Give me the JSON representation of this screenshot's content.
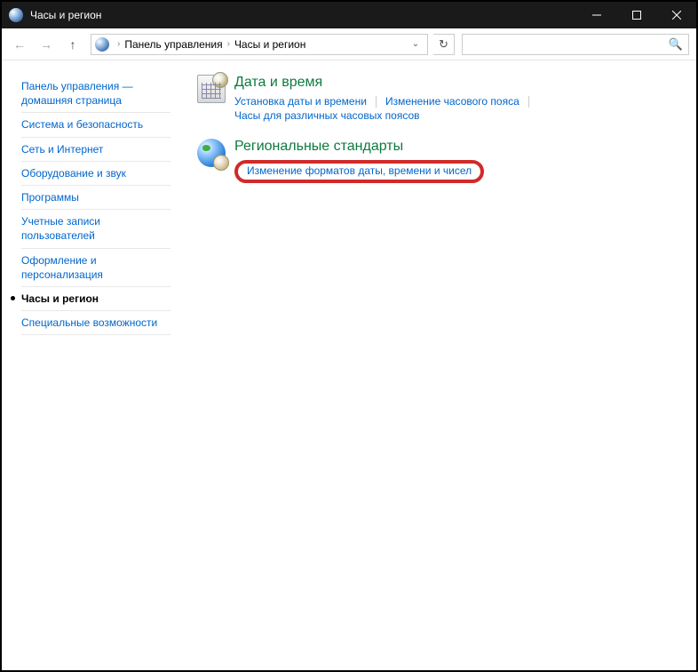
{
  "titlebar": {
    "title": "Часы и регион"
  },
  "breadcrumb": {
    "items": [
      "Панель управления",
      "Часы и регион"
    ]
  },
  "search": {
    "placeholder": ""
  },
  "sidebar": {
    "items": [
      {
        "label": "Панель управления — домашняя страница",
        "home": true
      },
      {
        "label": "Система и безопасность"
      },
      {
        "label": "Сеть и Интернет"
      },
      {
        "label": "Оборудование и звук"
      },
      {
        "label": "Программы"
      },
      {
        "label": "Учетные записи пользователей"
      },
      {
        "label": "Оформление и персонализация"
      },
      {
        "label": "Часы и регион",
        "active": true
      },
      {
        "label": "Специальные возможности"
      }
    ]
  },
  "sections": {
    "datetime": {
      "title": "Дата и время",
      "links": [
        "Установка даты и времени",
        "Изменение часового пояса",
        "Часы для различных часовых поясов"
      ]
    },
    "region": {
      "title": "Региональные стандарты",
      "highlighted_link": "Изменение форматов даты, времени и чисел"
    }
  }
}
